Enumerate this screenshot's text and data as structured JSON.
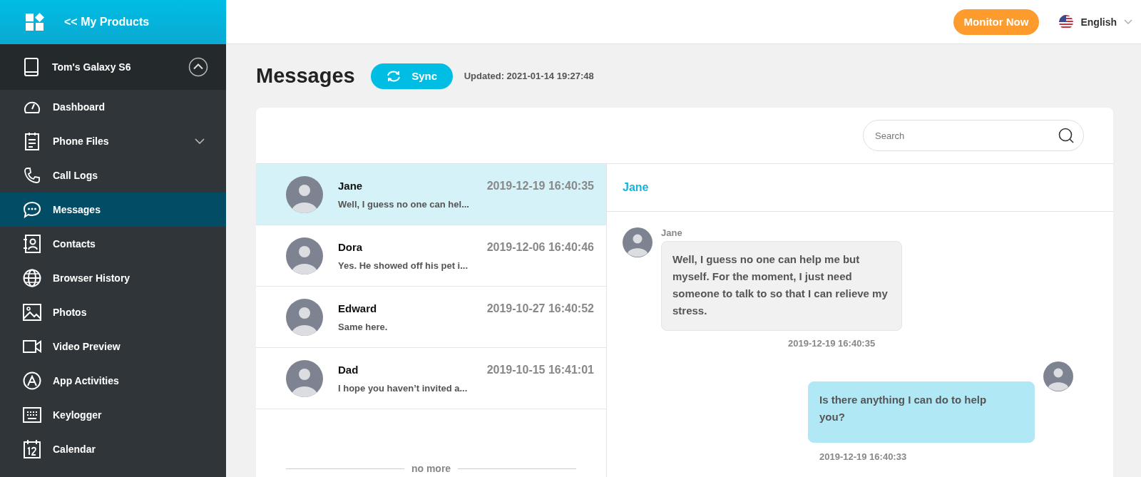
{
  "sidebar": {
    "products_link": "<< My Products",
    "device": {
      "name": "Tom's Galaxy S6",
      "expanded": true
    },
    "items": [
      {
        "label": "Dashboard",
        "selected": false
      },
      {
        "label": "Phone Files",
        "selected": false,
        "expanded": false
      },
      {
        "label": "Call Logs",
        "selected": false
      },
      {
        "label": "Messages",
        "selected": true
      },
      {
        "label": "Contacts",
        "selected": false
      },
      {
        "label": "Browser History",
        "selected": false
      },
      {
        "label": "Photos",
        "selected": false
      },
      {
        "label": "Video Preview",
        "selected": false
      },
      {
        "label": "App Activities",
        "selected": false
      },
      {
        "label": "Keylogger",
        "selected": false
      },
      {
        "label": "Calendar",
        "selected": false
      }
    ]
  },
  "top_bar": {
    "monitor_button": "Monitor Now",
    "language": "English"
  },
  "page": {
    "title": "Messages",
    "sync_button": "Sync",
    "updated": "Updated: 2021-01-14 19:27:48"
  },
  "search": {
    "placeholder": "Search"
  },
  "conversations": [
    {
      "name": "Jane",
      "time": "2019-12-19 16:40:35",
      "preview": "Well, I guess no one can hel...",
      "selected": true
    },
    {
      "name": "Dora",
      "time": "2019-12-06 16:40:46",
      "preview": "Yes. He showed off his pet i...",
      "selected": false
    },
    {
      "name": "Edward",
      "time": "2019-10-27 16:40:52",
      "preview": "Same here.",
      "selected": false
    },
    {
      "name": "Dad",
      "time": "2019-10-15 16:41:01",
      "preview": "I hope you haven’t invited a...",
      "selected": false
    }
  ],
  "list_end": "no more",
  "chat": {
    "contact": "Jane",
    "messages": [
      {
        "kind": "received",
        "sender": "Jane",
        "text": "Well, I guess no one can help me but myself. For the moment, I just need someone to talk to so that I can relieve my stress.",
        "time": "2019-12-19 16:40:35"
      },
      {
        "kind": "sent",
        "text": "Is there anything I can do to help you?",
        "time": "2019-12-19 16:40:33"
      }
    ]
  }
}
